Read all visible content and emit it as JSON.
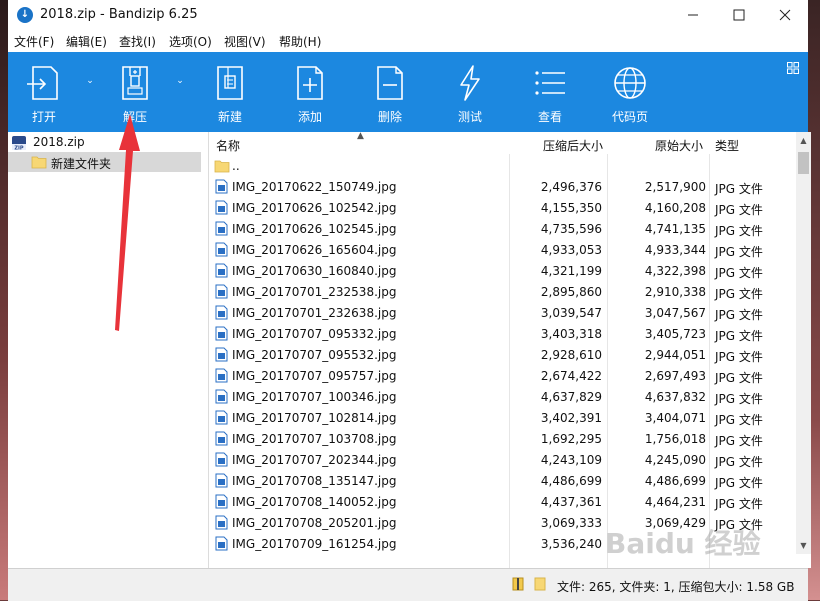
{
  "window": {
    "title": "2018.zip - Bandizip 6.25"
  },
  "menu": [
    "文件(F)",
    "编辑(E)",
    "查找(I)",
    "选项(O)",
    "视图(V)",
    "帮助(H)"
  ],
  "toolbar": {
    "open": "打开",
    "extract": "解压",
    "new": "新建",
    "add": "添加",
    "delete": "删除",
    "test": "测试",
    "view": "查看",
    "codepage": "代码页"
  },
  "tree": {
    "root": "2018.zip",
    "child": "新建文件夹"
  },
  "columns": {
    "name": "名称",
    "compressed": "压缩后大小",
    "original": "原始大小",
    "type": "类型"
  },
  "parent_dir": "..",
  "files": [
    {
      "name": "IMG_20170622_150749.jpg",
      "csize": "2,496,376",
      "osize": "2,517,900",
      "type": "JPG 文件"
    },
    {
      "name": "IMG_20170626_102542.jpg",
      "csize": "4,155,350",
      "osize": "4,160,208",
      "type": "JPG 文件"
    },
    {
      "name": "IMG_20170626_102545.jpg",
      "csize": "4,735,596",
      "osize": "4,741,135",
      "type": "JPG 文件"
    },
    {
      "name": "IMG_20170626_165604.jpg",
      "csize": "4,933,053",
      "osize": "4,933,344",
      "type": "JPG 文件"
    },
    {
      "name": "IMG_20170630_160840.jpg",
      "csize": "4,321,199",
      "osize": "4,322,398",
      "type": "JPG 文件"
    },
    {
      "name": "IMG_20170701_232538.jpg",
      "csize": "2,895,860",
      "osize": "2,910,338",
      "type": "JPG 文件"
    },
    {
      "name": "IMG_20170701_232638.jpg",
      "csize": "3,039,547",
      "osize": "3,047,567",
      "type": "JPG 文件"
    },
    {
      "name": "IMG_20170707_095332.jpg",
      "csize": "3,403,318",
      "osize": "3,405,723",
      "type": "JPG 文件"
    },
    {
      "name": "IMG_20170707_095532.jpg",
      "csize": "2,928,610",
      "osize": "2,944,051",
      "type": "JPG 文件"
    },
    {
      "name": "IMG_20170707_095757.jpg",
      "csize": "2,674,422",
      "osize": "2,697,493",
      "type": "JPG 文件"
    },
    {
      "name": "IMG_20170707_100346.jpg",
      "csize": "4,637,829",
      "osize": "4,637,832",
      "type": "JPG 文件"
    },
    {
      "name": "IMG_20170707_102814.jpg",
      "csize": "3,402,391",
      "osize": "3,404,071",
      "type": "JPG 文件"
    },
    {
      "name": "IMG_20170707_103708.jpg",
      "csize": "1,692,295",
      "osize": "1,756,018",
      "type": "JPG 文件"
    },
    {
      "name": "IMG_20170707_202344.jpg",
      "csize": "4,243,109",
      "osize": "4,245,090",
      "type": "JPG 文件"
    },
    {
      "name": "IMG_20170708_135147.jpg",
      "csize": "4,486,699",
      "osize": "4,486,699",
      "type": "JPG 文件"
    },
    {
      "name": "IMG_20170708_140052.jpg",
      "csize": "4,437,361",
      "osize": "4,464,231",
      "type": "JPG 文件"
    },
    {
      "name": "IMG_20170708_205201.jpg",
      "csize": "3,069,333",
      "osize": "3,069,429",
      "type": "JPG 文件"
    },
    {
      "name": "IMG_20170709_161254.jpg",
      "csize": "3,536,240",
      "osize": "",
      "type": ""
    }
  ],
  "status": {
    "text": "文件: 265, 文件夹: 1, 压缩包大小: 1.58 GB"
  },
  "watermark": "Baidu 经验",
  "colors": {
    "toolbar": "#1c88e0",
    "annotation_arrow": "#e8333a"
  }
}
